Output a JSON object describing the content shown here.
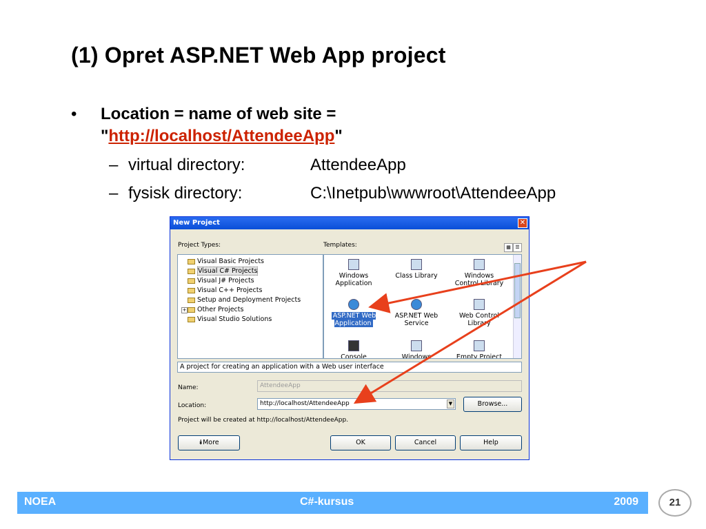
{
  "slide": {
    "title": "(1) Opret ASP.NET Web App project",
    "bullet": "•",
    "bullet_line1": "Location = name of web site =",
    "quote_open": "\"",
    "bullet_link": "http://localhost/AttendeeApp",
    "quote_close": "\"",
    "dash": "–",
    "sub_items": [
      {
        "label": "virtual directory:",
        "value": "AttendeeApp"
      },
      {
        "label": "fysisk directory:",
        "value": "C:\\Inetpub\\wwwroot\\AttendeeApp"
      }
    ]
  },
  "dialog": {
    "title": "New Project",
    "close_glyph": "✕",
    "project_types_label": "Project Types:",
    "templates_label": "Templates:",
    "project_types": [
      "Visual Basic Projects",
      "Visual C# Projects",
      "Visual J# Projects",
      "Visual C++ Projects",
      "Setup and Deployment Projects",
      "Other Projects",
      "Visual Studio Solutions"
    ],
    "templates": [
      "Windows Application",
      "Class Library",
      "Windows Control Library",
      "ASP.NET Web Application",
      "ASP.NET Web Service",
      "Web Control Library",
      "Console",
      "Windows Service",
      "Empty Project"
    ],
    "description": "A project for creating an application with a Web user interface",
    "name_label": "Name:",
    "name_value": "AttendeeApp",
    "location_label": "Location:",
    "location_value": "http://localhost/AttendeeApp",
    "browse_label": "Browse...",
    "created_at_text": "Project will be created at http://localhost/AttendeeApp.",
    "more_label": "More",
    "ok_label": "OK",
    "cancel_label": "Cancel",
    "help_label": "Help",
    "accent_color": "#e8401c"
  },
  "footer": {
    "left": "NOEA",
    "center": "C#-kursus",
    "right": "2009",
    "page": "21",
    "color": "#5ab0ff"
  }
}
